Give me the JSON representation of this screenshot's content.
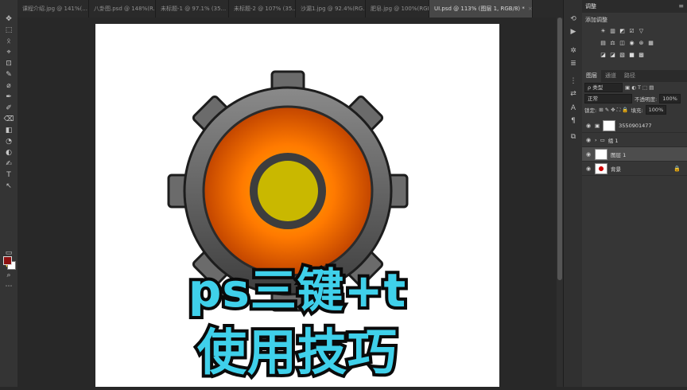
{
  "tabs": [
    {
      "label": "课程介绍.jpg @ 141%(...",
      "active": false
    },
    {
      "label": "八卦图.psd @ 148%(R...",
      "active": false
    },
    {
      "label": "未标题-1 @ 97.1% (35...",
      "active": false
    },
    {
      "label": "未标题-2 @ 107% (35...",
      "active": false
    },
    {
      "label": "沙漏1.jpg @ 92.4%(RG...",
      "active": false
    },
    {
      "label": "肥皂.jpg @ 100%(RGB...",
      "active": false
    },
    {
      "label": "UI.psd @ 113% (图层 1, RGB/8) *",
      "active": true
    }
  ],
  "tab_close": "×",
  "tools": [
    "✥",
    "⬚",
    "ᛟ",
    "⌖",
    "⊡",
    "✎",
    "⌀",
    "✒",
    "✐",
    "⌫",
    "◧",
    "◔",
    "◐",
    "✍",
    "T",
    "↖",
    "▭",
    "✋",
    "⌕",
    "⋯"
  ],
  "adjustments": {
    "header": "调整",
    "title": "添加调整",
    "row1": [
      "☀",
      "▥",
      "◩",
      "☑",
      "▽"
    ],
    "row2": [
      "▤",
      "⚖",
      "◫",
      "◉",
      "⊛",
      "▦"
    ],
    "row3": [
      "◪",
      "◪",
      "▧",
      "■",
      "▩"
    ]
  },
  "layers": {
    "tabs": [
      "图层",
      "通道",
      "路径"
    ],
    "filter_kind": "ρ 类型",
    "blend_mode": "正常",
    "opacity_label": "不透明度:",
    "opacity_value": "100%",
    "lock_label": "锁定:",
    "fill_label": "填充:",
    "fill_value": "100%",
    "items": [
      {
        "name": "3550901477",
        "type": "adjustment",
        "selected": false
      },
      {
        "name": "组 1",
        "type": "group",
        "selected": false
      },
      {
        "name": "图层 1",
        "type": "layer",
        "selected": true
      },
      {
        "name": "背景",
        "type": "background",
        "selected": false
      }
    ]
  },
  "overlay": {
    "line1": "ps三键+t",
    "line2": "使用技巧"
  },
  "colors": {
    "foreground": "#8c1010",
    "background": "#ffffff",
    "overlay_text": "#3fd0ea",
    "gear_center": "#c9b800",
    "gear_ring": "#ff6a00"
  }
}
